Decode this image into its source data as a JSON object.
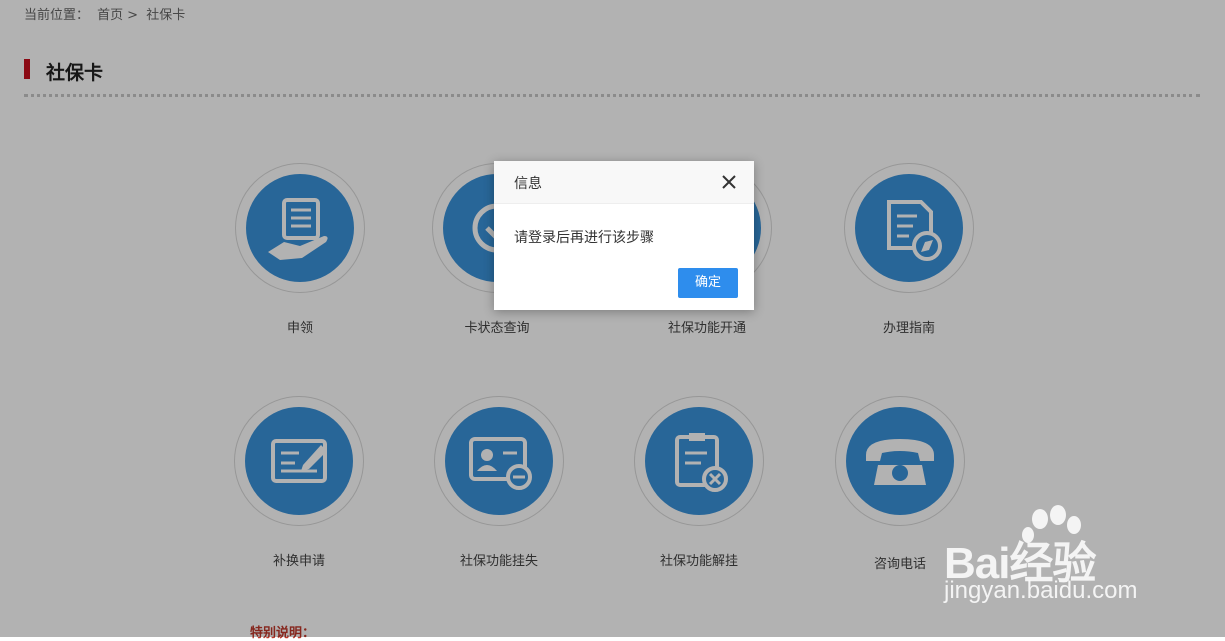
{
  "breadcrumb": {
    "prefix": "当前位置：",
    "home": "首页",
    "sep": ">",
    "current": "社保卡"
  },
  "page_title": "社保卡",
  "services": [
    {
      "label": "申领",
      "icon": "hand-document-icon"
    },
    {
      "label": "卡状态查询",
      "icon": "card-status-icon"
    },
    {
      "label": "社保功能开通",
      "icon": "function-open-icon"
    },
    {
      "label": "办理指南",
      "icon": "guide-compass-icon"
    },
    {
      "label": "补换申请",
      "icon": "edit-card-icon"
    },
    {
      "label": "社保功能挂失",
      "icon": "id-card-minus-icon"
    },
    {
      "label": "社保功能解挂",
      "icon": "clipboard-x-icon"
    },
    {
      "label": "咨询电话",
      "icon": "telephone-icon"
    }
  ],
  "note_title": "特别说明：",
  "dialog": {
    "title": "信息",
    "message": "请登录后再进行该步骤",
    "confirm": "确定"
  },
  "watermark": {
    "brand": "Bai经验",
    "url": "jingyan.baidu.com"
  },
  "colors": {
    "accent_red": "#c80f1e",
    "icon_blue": "#3a92da",
    "button_blue": "#2e8ded"
  }
}
